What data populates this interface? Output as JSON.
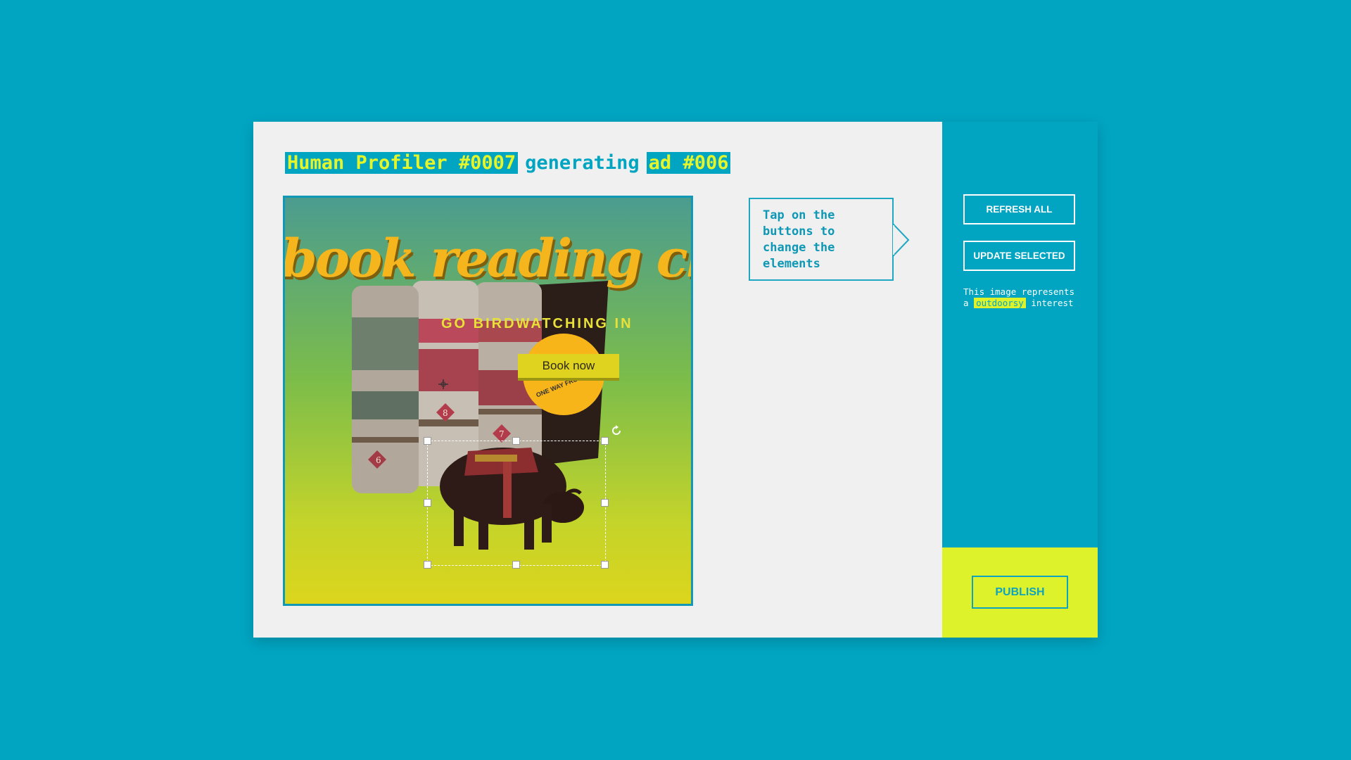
{
  "header": {
    "profiler": "Human Profiler #0007",
    "verb": "generating",
    "ad_number": "ad #006"
  },
  "ad": {
    "headline": "book reading clu",
    "subline": "GO BIRDWATCHING IN",
    "stamp": "ONE WAY FRO",
    "cta": "Book now"
  },
  "tip": {
    "text": "Tap on the buttons to change the elements"
  },
  "sidebar": {
    "refresh_label": "REFRESH ALL",
    "update_label": "UPDATE SELECTED",
    "note_prefix": "This image represents a",
    "interest": "outdoorsy",
    "note_suffix": "interest",
    "publish_label": "PUBLISH"
  },
  "colors": {
    "background": "#01a5c2",
    "card": "#f0f0f0",
    "accent": "#def22c",
    "headline_orange": "#f5b51c"
  },
  "icons": [
    "rotate-icon",
    "move-icon"
  ]
}
